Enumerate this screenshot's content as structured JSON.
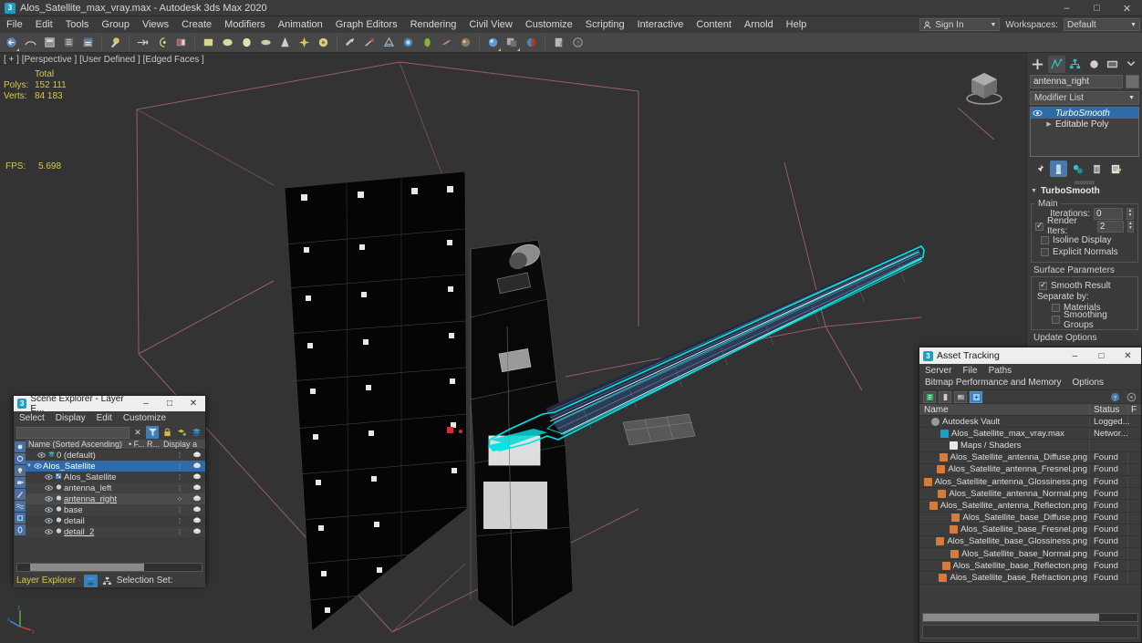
{
  "window": {
    "title": "Alos_Satellite_max_vray.max - Autodesk 3ds Max 2020",
    "app_icon": "3dsmax-icon",
    "minimize": "–",
    "maximize": "□",
    "close": "✕"
  },
  "menubar": {
    "items": [
      "File",
      "Edit",
      "Tools",
      "Group",
      "Views",
      "Create",
      "Modifiers",
      "Animation",
      "Graph Editors",
      "Rendering",
      "Civil View",
      "Customize",
      "Scripting",
      "Interactive",
      "Content",
      "Arnold",
      "Help"
    ],
    "sign_in": "Sign In",
    "workspaces_label": "Workspaces:",
    "workspaces_value": "Default"
  },
  "toolbar": {
    "groups": [
      [
        "undo-icon",
        "redo-icon",
        "select-link-icon",
        "unlink-icon",
        "bind-spacewarp-icon"
      ],
      [
        "select-object-icon",
        "select-by-name-icon",
        "select-region-icon",
        "window-crossing-icon"
      ],
      [
        "select-move-icon",
        "select-rotate-icon",
        "select-scale-icon",
        "placement-icon"
      ],
      [
        "reference-coordinate-icon",
        "use-center-icon",
        "select-manipulate-icon",
        "snaps-toggle-icon",
        "angle-snap-icon",
        "percent-snap-icon",
        "spinner-snap-icon"
      ],
      [
        "named-selection-sets-icon",
        "mirror-icon",
        "align-icon",
        "layer-explorer-icon",
        "curve-editor-icon",
        "schematic-view-icon",
        "material-editor-icon"
      ],
      [
        "render-setup-icon",
        "render-frame-icon",
        "render-production-icon"
      ],
      [
        "project-folder-icon",
        "help-icon"
      ]
    ]
  },
  "viewport": {
    "label": "[ + ] [Perspective ] [User Defined ] [Edged Faces ]",
    "stats_header": "Total",
    "stats": [
      {
        "label": "Polys:",
        "value": "152 111"
      },
      {
        "label": "Verts:",
        "value": "84 183"
      }
    ],
    "fps_label": "FPS:",
    "fps_value": "5.698",
    "selection_color": "#00e5e5",
    "grid_color": "#9b5a6a",
    "background": "#333333"
  },
  "command_panel": {
    "tabs": [
      "create-tab-icon",
      "modify-tab-icon",
      "hierarchy-tab-icon",
      "motion-tab-icon",
      "display-tab-icon",
      "utilities-tab-icon"
    ],
    "active_tab_index": 1,
    "object_name": "antenna_right",
    "modifier_list_label": "Modifier List",
    "stack": [
      {
        "name": "TurboSmooth",
        "selected": true,
        "visible": true
      },
      {
        "name": "Editable Poly",
        "selected": false,
        "visible": false
      }
    ],
    "stack_tools": [
      "pin-stack-icon",
      "show-end-result-icon",
      "make-unique-icon",
      "remove-modifier-icon",
      "configure-modifier-sets-icon"
    ],
    "rollout": {
      "title": "TurboSmooth",
      "main_group": "Main",
      "iterations_label": "Iterations:",
      "iterations_value": "0",
      "render_iters_label": "Render Iters:",
      "render_iters_value": "2",
      "render_iters_checked": true,
      "isoline_display": "Isoline Display",
      "isoline_checked": false,
      "explicit_normals": "Explicit Normals",
      "explicit_checked": false,
      "surface_parameters": "Surface Parameters",
      "smooth_result": "Smooth Result",
      "smooth_result_checked": true,
      "separate_by": "Separate by:",
      "materials": "Materials",
      "materials_checked": false,
      "smoothing_groups": "Smoothing Groups",
      "smoothing_groups_checked": false,
      "update_options": "Update Options"
    }
  },
  "scene_explorer": {
    "title": "Scene Explorer - Layer E...",
    "app_icon": "3dsmax-icon",
    "minimize": "–",
    "maximize": "□",
    "close": "✕",
    "menu": [
      "Select",
      "Display",
      "Edit",
      "Customize"
    ],
    "search_value": "",
    "search_clear": "✕",
    "columns": {
      "name": "Name (Sorted Ascending)",
      "frozen": "• F...",
      "render": "R...",
      "display": "Display a"
    },
    "rows": [
      {
        "name": "0 (default)",
        "indent": 1,
        "icon": "layer-icon",
        "expander": "",
        "selected": false,
        "highlight": false
      },
      {
        "name": "Alos_Satellite",
        "indent": 1,
        "icon": "layer-icon",
        "expander": "▼",
        "selected": true,
        "highlight": false
      },
      {
        "name": "Alos_Satellite",
        "indent": 2,
        "icon": "group-icon",
        "expander": "",
        "selected": false,
        "highlight": false
      },
      {
        "name": "antenna_left",
        "indent": 2,
        "icon": "object-icon",
        "expander": "",
        "selected": false,
        "highlight": false
      },
      {
        "name": "antenna_right",
        "indent": 2,
        "icon": "object-icon",
        "expander": "",
        "selected": false,
        "highlight": true
      },
      {
        "name": "base",
        "indent": 2,
        "icon": "object-icon",
        "expander": "",
        "selected": false,
        "highlight": false
      },
      {
        "name": "detail",
        "indent": 2,
        "icon": "object-icon",
        "expander": "",
        "selected": false,
        "highlight": false
      },
      {
        "name": "detail_2",
        "indent": 2,
        "icon": "object-icon",
        "expander": "",
        "selected": false,
        "highlight": false
      }
    ],
    "footer_label": "Layer Explorer",
    "selection_set_label": "Selection Set:"
  },
  "asset_tracking": {
    "title": "Asset Tracking",
    "app_icon": "3dsmax-icon",
    "minimize": "–",
    "maximize": "□",
    "close": "✕",
    "menu": [
      "Server",
      "File",
      "Paths",
      "Bitmap Performance and Memory",
      "Options"
    ],
    "toolbar": [
      "list-view-icon",
      "detail-view-icon",
      "thumbnail-icon",
      "refresh-icon",
      "help-icon",
      "settings-icon"
    ],
    "columns": {
      "name": "Name",
      "status": "Status",
      "full": "F"
    },
    "rows": [
      {
        "name": "Autodesk Vault",
        "status": "Logged...",
        "indent": 1,
        "icon": "vault-icon",
        "icon_color": "#9a9a9a"
      },
      {
        "name": "Alos_Satellite_max_vray.max",
        "status": "Networ...",
        "indent": 2,
        "icon": "max-file-icon",
        "icon_color": "#1f9ec4"
      },
      {
        "name": "Maps / Shaders",
        "status": "",
        "indent": 3,
        "icon": "folder-icon",
        "icon_color": "#e8e8e8"
      },
      {
        "name": "Alos_Satellite_antenna_Diffuse.png",
        "status": "Found",
        "indent": 4,
        "icon": "bitmap-icon",
        "icon_color": "#d87a3a"
      },
      {
        "name": "Alos_Satellite_antenna_Fresnel.png",
        "status": "Found",
        "indent": 4,
        "icon": "bitmap-icon",
        "icon_color": "#d87a3a"
      },
      {
        "name": "Alos_Satellite_antenna_Glossiness.png",
        "status": "Found",
        "indent": 4,
        "icon": "bitmap-icon",
        "icon_color": "#d87a3a"
      },
      {
        "name": "Alos_Satellite_antenna_Normal.png",
        "status": "Found",
        "indent": 4,
        "icon": "bitmap-icon",
        "icon_color": "#d87a3a"
      },
      {
        "name": "Alos_Satellite_antenna_Reflecton.png",
        "status": "Found",
        "indent": 4,
        "icon": "bitmap-icon",
        "icon_color": "#d87a3a"
      },
      {
        "name": "Alos_Satellite_base_Diffuse.png",
        "status": "Found",
        "indent": 4,
        "icon": "bitmap-icon",
        "icon_color": "#d87a3a"
      },
      {
        "name": "Alos_Satellite_base_Fresnel.png",
        "status": "Found",
        "indent": 4,
        "icon": "bitmap-icon",
        "icon_color": "#d87a3a"
      },
      {
        "name": "Alos_Satellite_base_Glossiness.png",
        "status": "Found",
        "indent": 4,
        "icon": "bitmap-icon",
        "icon_color": "#d87a3a"
      },
      {
        "name": "Alos_Satellite_base_Normal.png",
        "status": "Found",
        "indent": 4,
        "icon": "bitmap-icon",
        "icon_color": "#d87a3a"
      },
      {
        "name": "Alos_Satellite_base_Reflecton.png",
        "status": "Found",
        "indent": 4,
        "icon": "bitmap-icon",
        "icon_color": "#d87a3a"
      },
      {
        "name": "Alos_Satellite_base_Refraction.png",
        "status": "Found",
        "indent": 4,
        "icon": "bitmap-icon",
        "icon_color": "#d87a3a"
      }
    ]
  }
}
